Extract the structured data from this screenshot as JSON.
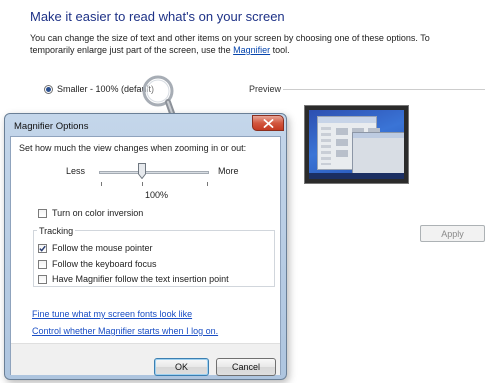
{
  "page": {
    "heading": "Make it easier to read what's on your screen",
    "intro_line1": "You can change the size of text and other items on your screen by choosing one of these options. To",
    "intro_line2_before": "temporarily enlarge just part of the screen, use the ",
    "intro_link": "Magnifier",
    "intro_line2_after": " tool.",
    "size_option_label": "Smaller - 100% (default)",
    "size_option_selected": true,
    "preview_label": "Preview",
    "apply_label": "Apply",
    "apply_enabled": false
  },
  "dialog": {
    "title": "Magnifier Options",
    "zoom_caption": "Set how much the view changes when zooming in or out:",
    "less_label": "Less",
    "more_label": "More",
    "zoom_value": "100%",
    "color_inversion_label": "Turn on color inversion",
    "color_inversion_checked": false,
    "tracking_label": "Tracking",
    "tracking": {
      "follow_mouse_label": "Follow the mouse pointer",
      "follow_mouse_checked": true,
      "follow_keyboard_label": "Follow the keyboard focus",
      "follow_keyboard_checked": false,
      "follow_text_label": "Have Magnifier follow the text insertion point",
      "follow_text_checked": false
    },
    "link_fonts": "Fine tune what my screen fonts look like",
    "link_startup": "Control whether Magnifier starts when I log on.",
    "ok_label": "OK",
    "cancel_label": "Cancel"
  },
  "colors": {
    "heading": "#1e3287",
    "link": "#1a4ec4",
    "dialog_frame": "#b6cbe3",
    "close_button": "#c43a22"
  },
  "icons": {
    "close": "close-x-icon",
    "checkmark": "checkmark-icon",
    "magnifier": "magnifier-cursor-icon",
    "slider": "slider-thumb-icon"
  }
}
